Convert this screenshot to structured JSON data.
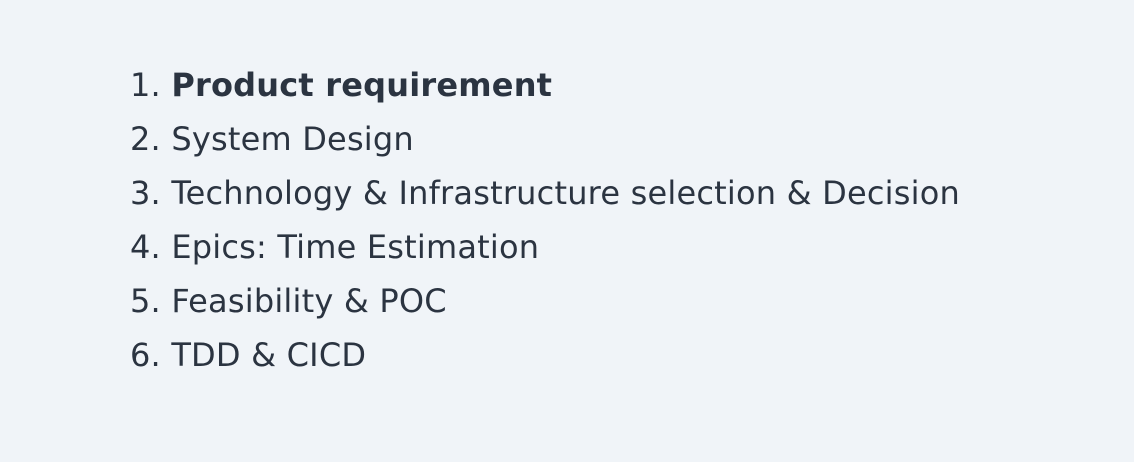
{
  "list": {
    "items": [
      {
        "number": "1.",
        "text": "Product requirement",
        "bold": true
      },
      {
        "number": "2.",
        "text": "System Design",
        "bold": false
      },
      {
        "number": "3.",
        "text": "Technology & Infrastructure selection & Decision",
        "bold": false
      },
      {
        "number": "4.",
        "text": "Epics: Time Estimation",
        "bold": false
      },
      {
        "number": "5.",
        "text": "Feasibility & POC",
        "bold": false
      },
      {
        "number": "6.",
        "text": "TDD & CICD",
        "bold": false
      }
    ]
  },
  "colors": {
    "background": "#f0f4f8",
    "text": "#2b3441"
  }
}
